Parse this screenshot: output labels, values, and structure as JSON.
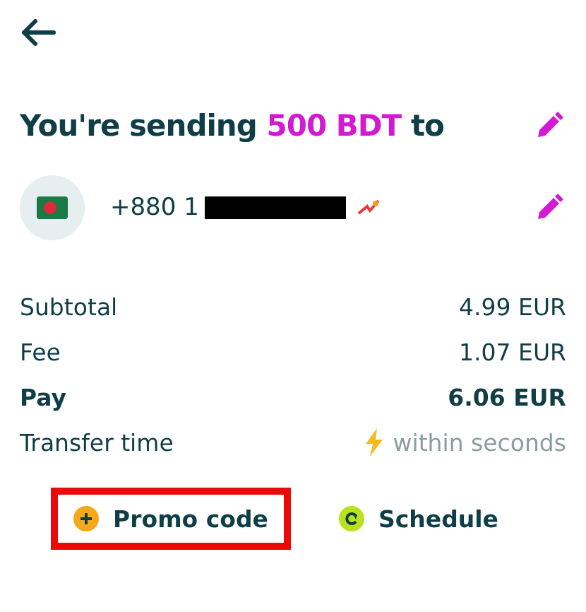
{
  "heading": {
    "prefix": "You're sending",
    "amount": "500 BDT",
    "suffix": "to"
  },
  "recipient": {
    "phone": "+880 1",
    "redacted": true
  },
  "summary": [
    {
      "kind": "normal",
      "label": "Subtotal",
      "value": "4.99 EUR"
    },
    {
      "kind": "normal",
      "label": "Fee",
      "value": "1.07 EUR"
    },
    {
      "kind": "total",
      "label": "Pay",
      "value": "6.06 EUR"
    },
    {
      "kind": "time",
      "label": "Transfer time",
      "value": "within seconds"
    }
  ],
  "actions": [
    {
      "kind": "promo",
      "label": "Promo code",
      "highlighted": true
    },
    {
      "kind": "schedule",
      "label": "Schedule",
      "highlighted": false
    }
  ]
}
